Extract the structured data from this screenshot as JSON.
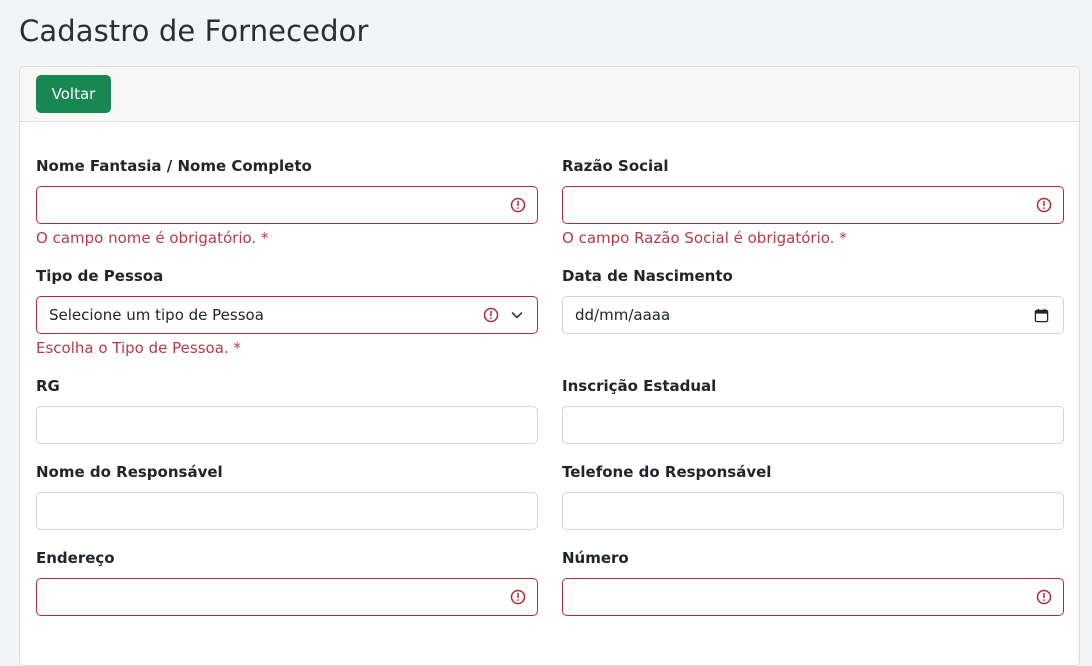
{
  "page": {
    "title": "Cadastro de Fornecedor"
  },
  "header": {
    "back_label": "Voltar"
  },
  "form": {
    "nome": {
      "label": "Nome Fantasia / Nome Completo",
      "value": "",
      "error": "O campo nome é obrigatório. *"
    },
    "razao": {
      "label": "Razão Social",
      "value": "",
      "error": "O campo Razão Social é obrigatório. *"
    },
    "tipo": {
      "label": "Tipo de Pessoa",
      "selected": "Selecione um tipo de Pessoa",
      "error": "Escolha o Tipo de Pessoa. *"
    },
    "nascimento": {
      "label": "Data de Nascimento",
      "placeholder": "dd/mm/aaaa"
    },
    "rg": {
      "label": "RG",
      "value": ""
    },
    "ie": {
      "label": "Inscrição Estadual",
      "value": ""
    },
    "responsavel": {
      "label": "Nome do Responsável",
      "value": ""
    },
    "telefone": {
      "label": "Telefone do Responsável",
      "value": ""
    },
    "endereco": {
      "label": "Endereço",
      "value": ""
    },
    "numero": {
      "label": "Número",
      "value": ""
    }
  },
  "colors": {
    "primary_button": "#198754",
    "error": "#b83a47",
    "invalid_border": "#b02a37"
  },
  "icons": {
    "invalid": "alert-circle-icon",
    "select": "chevron-down-icon",
    "date": "calendar-icon"
  }
}
